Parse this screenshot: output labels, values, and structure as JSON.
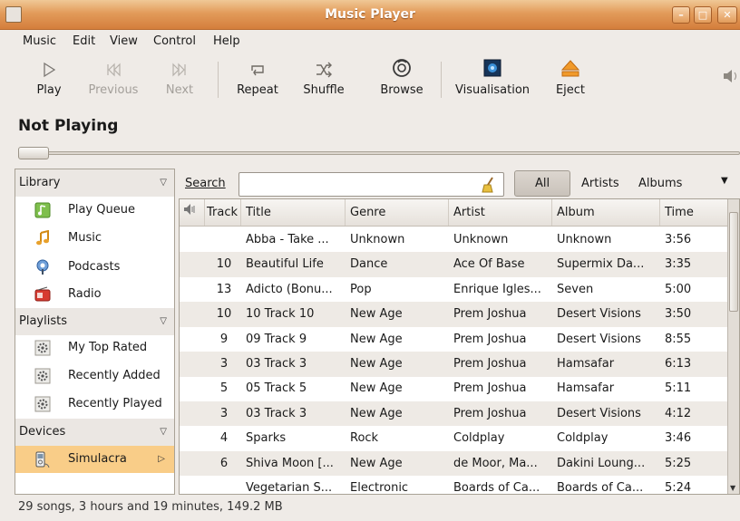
{
  "window": {
    "title": "Music Player"
  },
  "menu": [
    "Music",
    "Edit",
    "View",
    "Control",
    "Help"
  ],
  "toolbar": {
    "play": "Play",
    "previous": "Previous",
    "next": "Next",
    "repeat": "Repeat",
    "shuffle": "Shuffle",
    "browse": "Browse",
    "visualisation": "Visualisation",
    "eject": "Eject"
  },
  "now_playing": "Not Playing",
  "sidebar": {
    "library_header": "Library",
    "library": [
      "Play Queue",
      "Music",
      "Podcasts",
      "Radio"
    ],
    "playlists_header": "Playlists",
    "playlists": [
      "My Top Rated",
      "Recently Added",
      "Recently Played"
    ],
    "devices_header": "Devices",
    "devices": [
      "Simulacra"
    ]
  },
  "search": {
    "label": "Search",
    "value": ""
  },
  "filters": {
    "all": "All",
    "artists": "Artists",
    "albums": "Albums"
  },
  "columns": [
    "Track",
    "Title",
    "Genre",
    "Artist",
    "Album",
    "Time"
  ],
  "rows": [
    [
      "",
      "Abba - Take ...",
      "Unknown",
      "Unknown",
      "Unknown",
      "3:56"
    ],
    [
      "10",
      "Beautiful Life",
      "Dance",
      "Ace Of Base",
      "Supermix Da...",
      "3:35"
    ],
    [
      "13",
      "Adicto (Bonu...",
      "Pop",
      "Enrique Igles...",
      "Seven",
      "5:00"
    ],
    [
      "10",
      "10 Track 10",
      "New Age",
      "Prem Joshua",
      "Desert Visions",
      "3:50"
    ],
    [
      "9",
      "09 Track 9",
      "New Age",
      "Prem Joshua",
      "Desert Visions",
      "8:55"
    ],
    [
      "3",
      "03 Track 3",
      "New Age",
      "Prem Joshua",
      "Hamsafar",
      "6:13"
    ],
    [
      "5",
      "05 Track 5",
      "New Age",
      "Prem Joshua",
      "Hamsafar",
      "5:11"
    ],
    [
      "3",
      "03 Track 3",
      "New Age",
      "Prem Joshua",
      "Desert Visions",
      "4:12"
    ],
    [
      "4",
      "Sparks",
      "Rock",
      "Coldplay",
      "Coldplay",
      "3:46"
    ],
    [
      "6",
      "Shiva Moon [...",
      "New Age",
      "de Moor, Ma...",
      "Dakini Loung...",
      "5:25"
    ],
    [
      "",
      "Vegetarian S...",
      "Electronic",
      "Boards of Ca...",
      "Boards of Ca...",
      "5:24"
    ]
  ],
  "status": "29 songs, 3 hours and 19 minutes, 149.2 MB"
}
